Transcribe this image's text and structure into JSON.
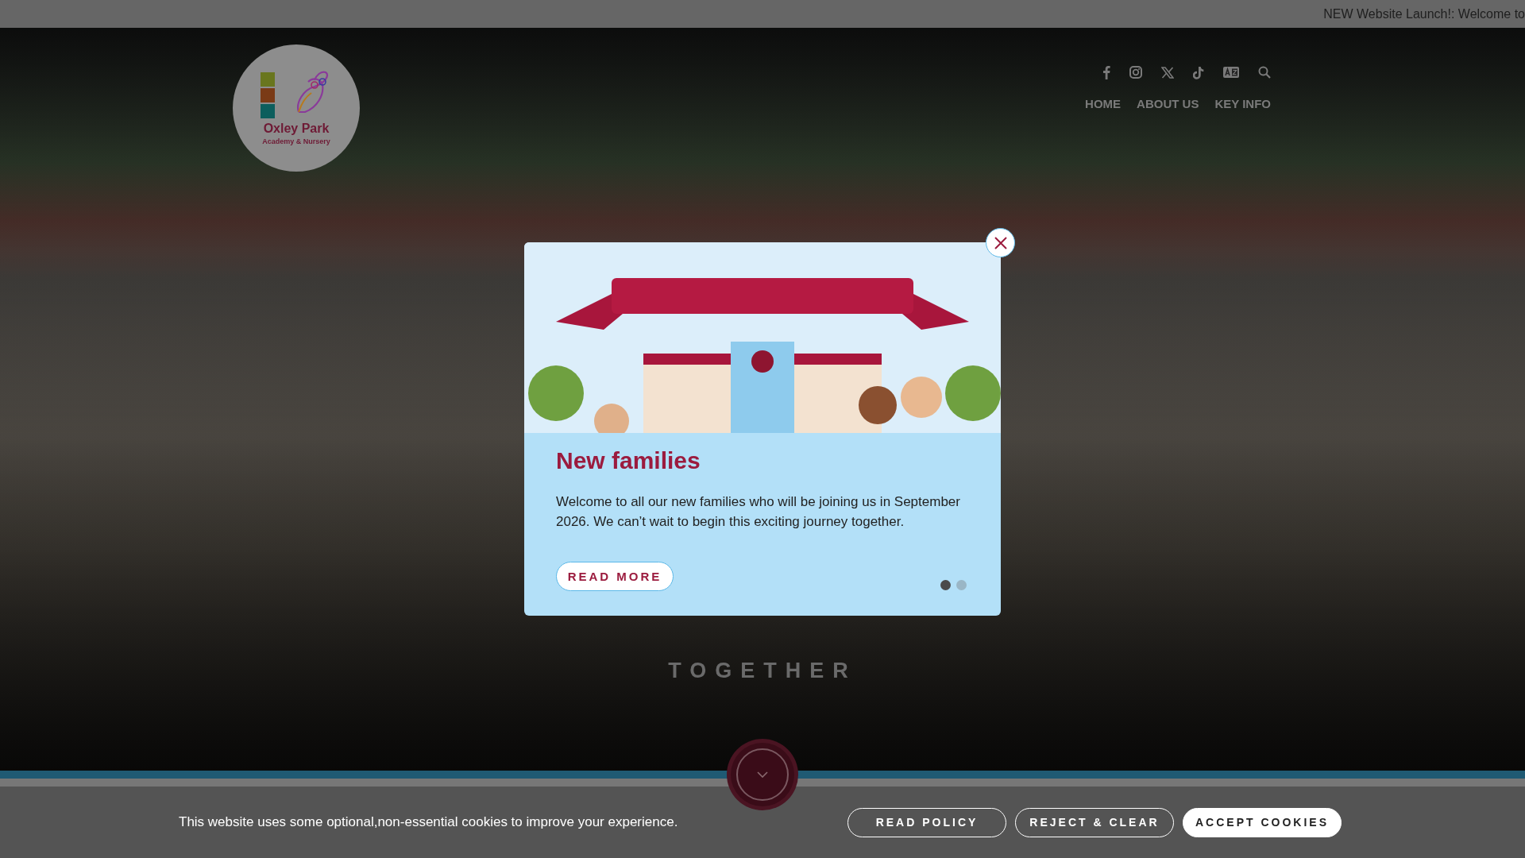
{
  "top_bar": {
    "announcement": "NEW Website Launch!: Welcome to"
  },
  "header": {
    "logo": {
      "name": "Oxley Park",
      "subtitle": "Academy & Nursery"
    },
    "social_links": [
      {
        "kind": "facebook"
      },
      {
        "kind": "instagram"
      },
      {
        "kind": "x"
      },
      {
        "kind": "tiktok"
      },
      {
        "kind": "translate"
      },
      {
        "kind": "search"
      }
    ],
    "nav": [
      {
        "label": "HOME"
      },
      {
        "label": "ABOUT US"
      },
      {
        "label": "KEY INFO"
      }
    ]
  },
  "hero": {
    "tagline": "TOGETHER"
  },
  "popup": {
    "title": "New families",
    "body": "Welcome to all our new families who will be joining us in September 2026. We can’t wait to begin this exciting journey together.",
    "button": "READ MORE",
    "dots": [
      {
        "selected": true
      },
      {
        "selected": false
      }
    ]
  },
  "cookie_banner": {
    "message": "This website uses some optional,non-essential cookies to improve your experience.",
    "buttons": [
      {
        "label": "READ POLICY",
        "kind": "outline"
      },
      {
        "label": "REJECT & CLEAR",
        "kind": "outline"
      },
      {
        "label": "ACCEPT COOKIES",
        "kind": "filled"
      }
    ]
  }
}
